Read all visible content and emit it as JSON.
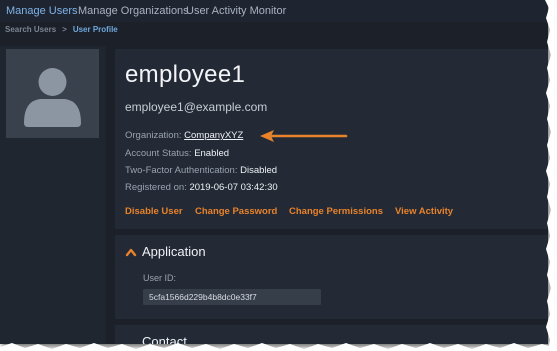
{
  "topnav": {
    "items": [
      {
        "label": "Manage Users",
        "active": true
      },
      {
        "label": "Manage Organizations",
        "active": false
      },
      {
        "label": "User Activity Monitor",
        "active": false
      }
    ]
  },
  "breadcrumb": {
    "items": [
      "Search Users",
      "User Profile"
    ],
    "separator": ">"
  },
  "profile": {
    "username": "employee1",
    "email": "employee1@example.com",
    "organization_label": "Organization:",
    "organization_value": "CompanyXYZ",
    "status_label": "Account Status:",
    "status_value": "Enabled",
    "twofa_label": "Two-Factor Authentication:",
    "twofa_value": "Disabled",
    "registered_label": "Registered on:",
    "registered_value": "2019-06-07 03:42:30",
    "avatar_icon": "user-silhouette-icon"
  },
  "actions": {
    "disable": "Disable User",
    "change_password": "Change Password",
    "change_permissions": "Change Permissions",
    "view_activity": "View Activity"
  },
  "application": {
    "title": "Application",
    "user_id_label": "User ID:",
    "user_id_value": "5cfa1566d229b4b8dc0e33f7",
    "chevron_icon": "chevron-up-icon"
  },
  "contact": {
    "title": "Contact"
  },
  "annotation": {
    "arrow_icon": "orange-arrow-icon",
    "color": "#e8822b"
  },
  "colors": {
    "background": "#1b2029",
    "panel": "#232a35",
    "accent": "#e8822b",
    "link_active": "#7fb3e8"
  }
}
